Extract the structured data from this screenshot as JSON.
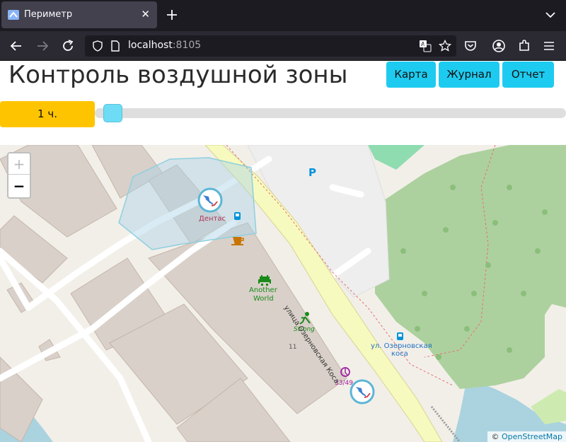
{
  "browser": {
    "tab_title": "Периметр",
    "tab_close": "✕",
    "url_host": "localhost",
    "url_port": ":8105"
  },
  "app": {
    "title": "Контроль воздушной зоны",
    "nav": [
      {
        "label": "Карта"
      },
      {
        "label": "Журнал"
      },
      {
        "label": "Отчет"
      }
    ],
    "accent_color": "#1ecbf0",
    "time_badge": "1 ч.",
    "time_badge_color": "#ffc400",
    "slider_value": 0
  },
  "map": {
    "zoom_in": "+",
    "zoom_out": "−",
    "labels": {
      "dentas": "Дентас",
      "another_world_1": "Another",
      "another_world_2": "World",
      "strong": "Strong",
      "house_11": "11",
      "house_33": "33/49",
      "street": "улица Озерновская Коса",
      "stop_1": "ул. Озерновская",
      "stop_2": "коса",
      "parking": "P"
    },
    "attribution_prefix": "© ",
    "attribution_link": "OpenStreetMap",
    "drone_markers": [
      "drone-marker-north",
      "drone-marker-south"
    ]
  }
}
